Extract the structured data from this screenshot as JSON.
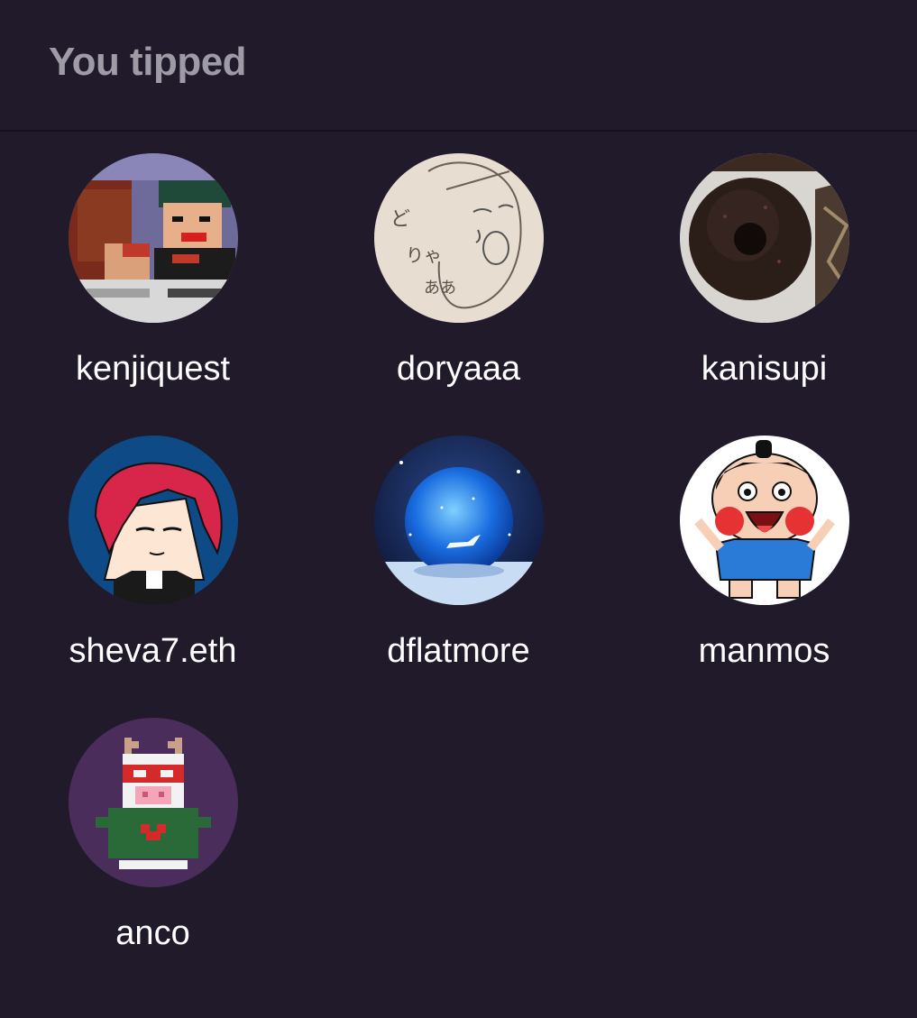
{
  "header": {
    "title": "You tipped"
  },
  "users": [
    {
      "name": "kenjiquest",
      "avatar_icon": "pixel-art-couple-icon"
    },
    {
      "name": "doryaaa",
      "avatar_icon": "sketch-face-icon"
    },
    {
      "name": "kanisupi",
      "avatar_icon": "chocolate-donut-icon"
    },
    {
      "name": "sheva7.eth",
      "avatar_icon": "red-hair-anime-icon"
    },
    {
      "name": "dflatmore",
      "avatar_icon": "crystal-ball-unicorn-icon"
    },
    {
      "name": "manmos",
      "avatar_icon": "cartoon-boy-icon"
    },
    {
      "name": "anco",
      "avatar_icon": "pixel-cow-sweater-icon"
    }
  ]
}
